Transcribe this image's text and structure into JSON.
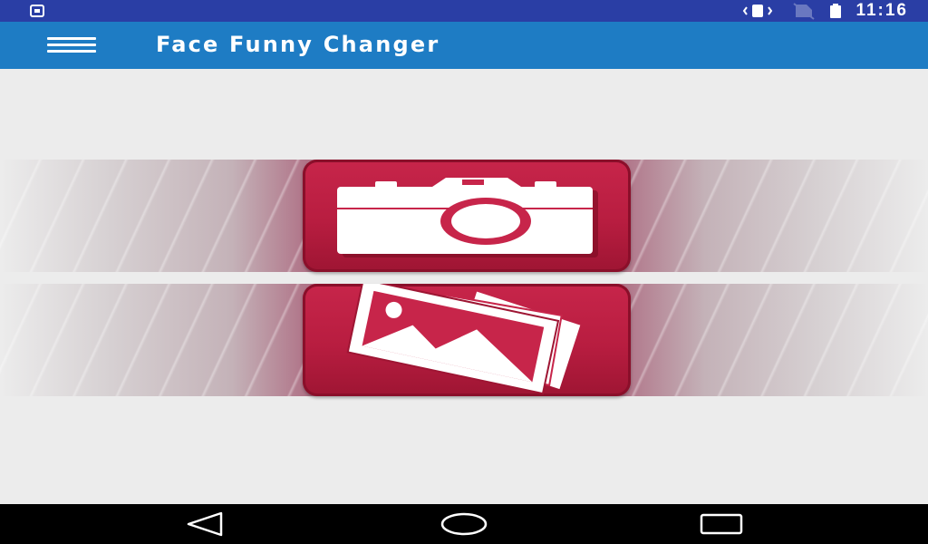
{
  "status_bar": {
    "time": "11:16",
    "icons": [
      "screenshot-icon",
      "vibrate-icon",
      "no-sim-icon",
      "battery-icon"
    ],
    "background": "#2a3ea5"
  },
  "app_bar": {
    "title": "Face Funny Changer",
    "menu_icon": "hamburger-menu-icon",
    "background": "#1e7cc4"
  },
  "main": {
    "buttons": [
      {
        "action": "camera",
        "icon": "camera-icon",
        "color": "#c7254a"
      },
      {
        "action": "gallery",
        "icon": "gallery-photos-icon",
        "color": "#c7254a"
      }
    ]
  },
  "nav_bar": {
    "icons": [
      "back-icon",
      "home-icon",
      "recents-icon"
    ]
  }
}
